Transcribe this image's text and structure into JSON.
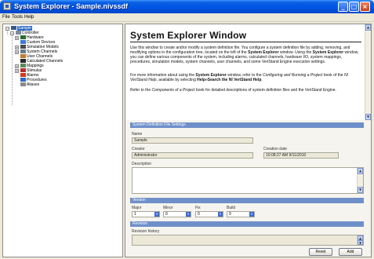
{
  "window": {
    "title": "System Explorer - Sample.nivssdf",
    "controls": {
      "minimize": "_",
      "maximize": "□",
      "close": "×"
    }
  },
  "menu": [
    "File",
    "Tools",
    "Help"
  ],
  "tree": {
    "root": "Sample",
    "controller": "Controller",
    "items": [
      "Hardware",
      "Custom Devices",
      "Simulation Models",
      "System Channels",
      "User Channels",
      "Calculated Channels",
      "Mappings",
      "Stimulus",
      "Alarms",
      "Procedures",
      "Aliases"
    ]
  },
  "help": {
    "title": "System Explorer Window",
    "p1_parts": [
      "Use this window to create and/or modify a system definition file. You configure a system definition file by adding, removing, and modifying options in the configuration tree, located on the left of the ",
      "System Explorer",
      " window. Using the ",
      "System Explorer",
      " window, you can define various components of the system, including alarms, calculated channels, hardware I/O, system mappings, procedures, simulation models, system channels, user channels, and some VeriStand Engine execution settings."
    ],
    "p2_parts": [
      "For more information about using the ",
      "System Explorer",
      " window, refer to the ",
      "Configuring and Running a Project",
      " book of the ",
      "NI VeriStand Help",
      ", available by selecting ",
      "Help»Search the NI VeriStand Help",
      "."
    ],
    "p3_parts": [
      "Refer to the ",
      "Components of a Project",
      " book for detailed descriptions of system definition files and the VeriStand Engine."
    ]
  },
  "settings": {
    "section_title": "System Definition File Settings",
    "name_label": "Name",
    "name_value": "Sample",
    "creator_label": "Creator",
    "creator_value": "Administrator",
    "creation_date_label": "Creation date",
    "creation_date_value": "10:08:27 AM 9/11/2010",
    "description_label": "Description"
  },
  "version": {
    "section_title": "Version",
    "labels": [
      "Major",
      "Minor",
      "Fix",
      "Build"
    ],
    "values": [
      "1",
      "0",
      "0",
      "0"
    ]
  },
  "revision": {
    "section_title": "Revision",
    "history_label": "Revision history"
  },
  "buttons": {
    "reset": "Reset",
    "add": "Add"
  },
  "colors": {
    "titlebar": "#0055e5",
    "section_bar": "#6f8fc9",
    "selection": "#316ac5"
  }
}
